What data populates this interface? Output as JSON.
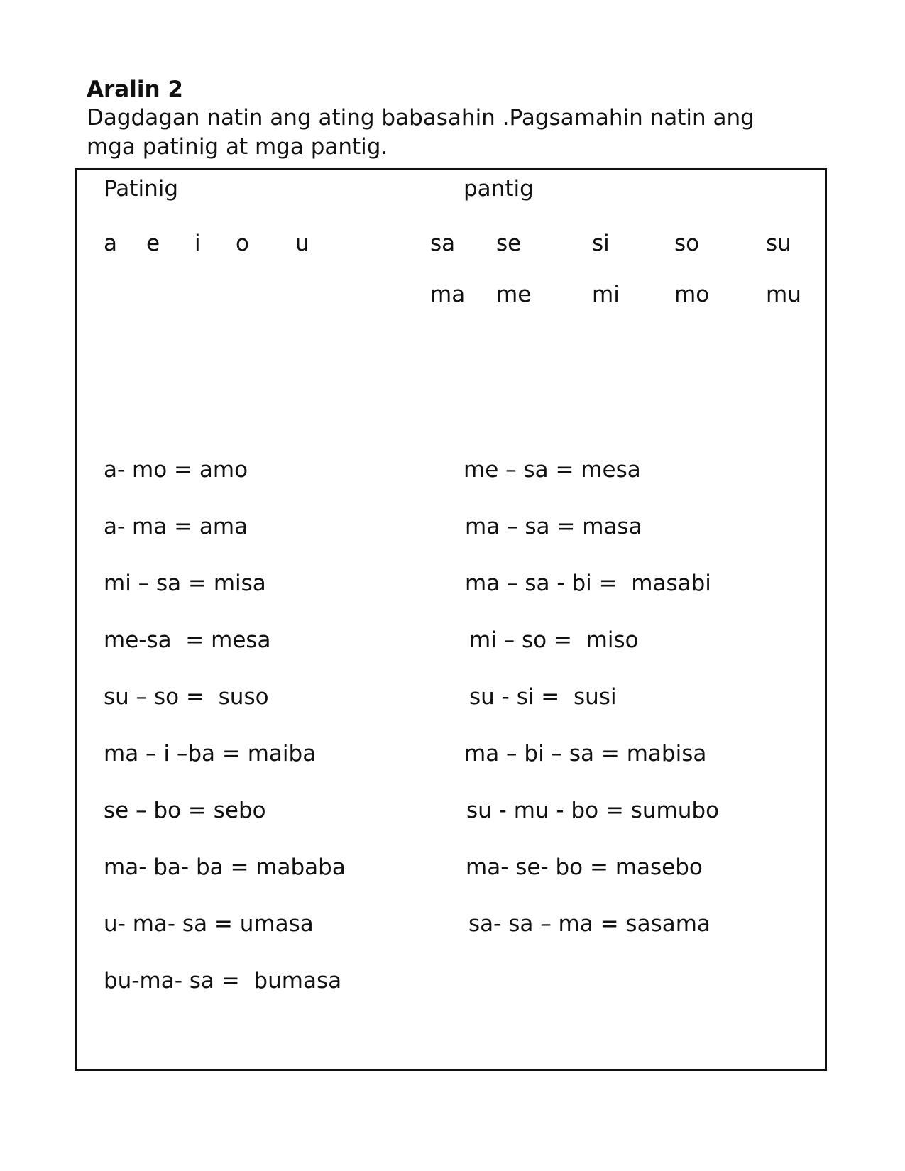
{
  "lesson_title": "Aralin 2",
  "instructions": {
    "line1": "Dagdagan natin ang ating babasahin .Pagsamahin natin ang",
    "line2": "mga patinig at mga pantig."
  },
  "headers": {
    "vowels": "Patinig",
    "syllables": "pantig"
  },
  "vowels": [
    "a",
    "e",
    "i",
    "o",
    "u"
  ],
  "syllable_rows": [
    [
      "sa",
      "se",
      "si",
      "so",
      "su"
    ],
    [
      "ma",
      "me",
      "mi",
      "mo",
      "mu"
    ]
  ],
  "left_words": [
    "a- mo = amo",
    "a- ma = ama",
    "mi – sa = misa",
    "me-sa  = mesa",
    "su – so =  suso",
    "ma – i –ba = maiba",
    "se – bo = sebo",
    "ma- ba- ba = mababa",
    "u- ma- sa = umasa",
    "bu-ma- sa =  bumasa"
  ],
  "right_words": [
    "me – sa = mesa",
    "ma – sa = masa",
    "ma – sa - bi =  masabi",
    "mi – so =  miso",
    "su - si =  susi",
    "ma – bi – sa = mabisa",
    "su - mu - bo = sumubo",
    "ma- se- bo = masebo",
    "sa- sa – ma = sasama"
  ]
}
